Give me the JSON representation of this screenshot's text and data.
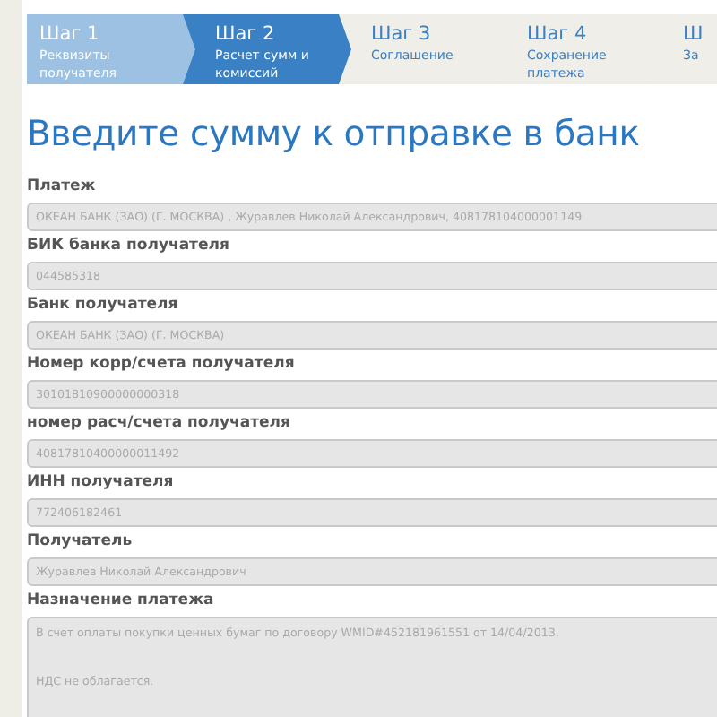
{
  "steps": [
    {
      "number": "Шаг 1",
      "label": "Реквизиты получателя",
      "completed": true,
      "selected": false
    },
    {
      "number": "Шаг 2",
      "label": "Расчет сумм и комиссий",
      "completed": false,
      "selected": true
    },
    {
      "number": "Шаг 3",
      "label": "Соглашение",
      "completed": false,
      "selected": false
    },
    {
      "number": "Шаг 4",
      "label": "Сохранение платежа",
      "completed": false,
      "selected": false
    },
    {
      "number": "Ш",
      "label": "За",
      "completed": false,
      "selected": false
    }
  ],
  "title": "Введите сумму к отправке в банк",
  "fields": [
    {
      "kind": "input",
      "label": "Платеж",
      "value": "ОКЕАН БАНК (ЗАО) (Г. МОСКВА) , Журавлев Николай Александрович, 408178104000001149"
    },
    {
      "kind": "input",
      "label": "БИК банка получателя",
      "value": "044585318"
    },
    {
      "kind": "input",
      "label": "Банк получателя",
      "value": "ОКЕАН БАНК (ЗАО) (Г. МОСКВА)"
    },
    {
      "kind": "input",
      "label": "Номер корр/счета получателя",
      "value": "30101810900000000318"
    },
    {
      "kind": "input",
      "label": "номер расч/счета получателя",
      "value": "40817810400000011492"
    },
    {
      "kind": "input",
      "label": "ИНН получателя",
      "value": "772406182461"
    },
    {
      "kind": "input",
      "label": "Получатель",
      "value": "Журавлев Николай Александрович"
    },
    {
      "kind": "textarea",
      "label": "Назначение платежа",
      "value": "В счет оплаты покупки ценных бумаг по договору WMID#452181961551 от 14/04/2013.\n\n\nНДС не облагается."
    }
  ]
}
